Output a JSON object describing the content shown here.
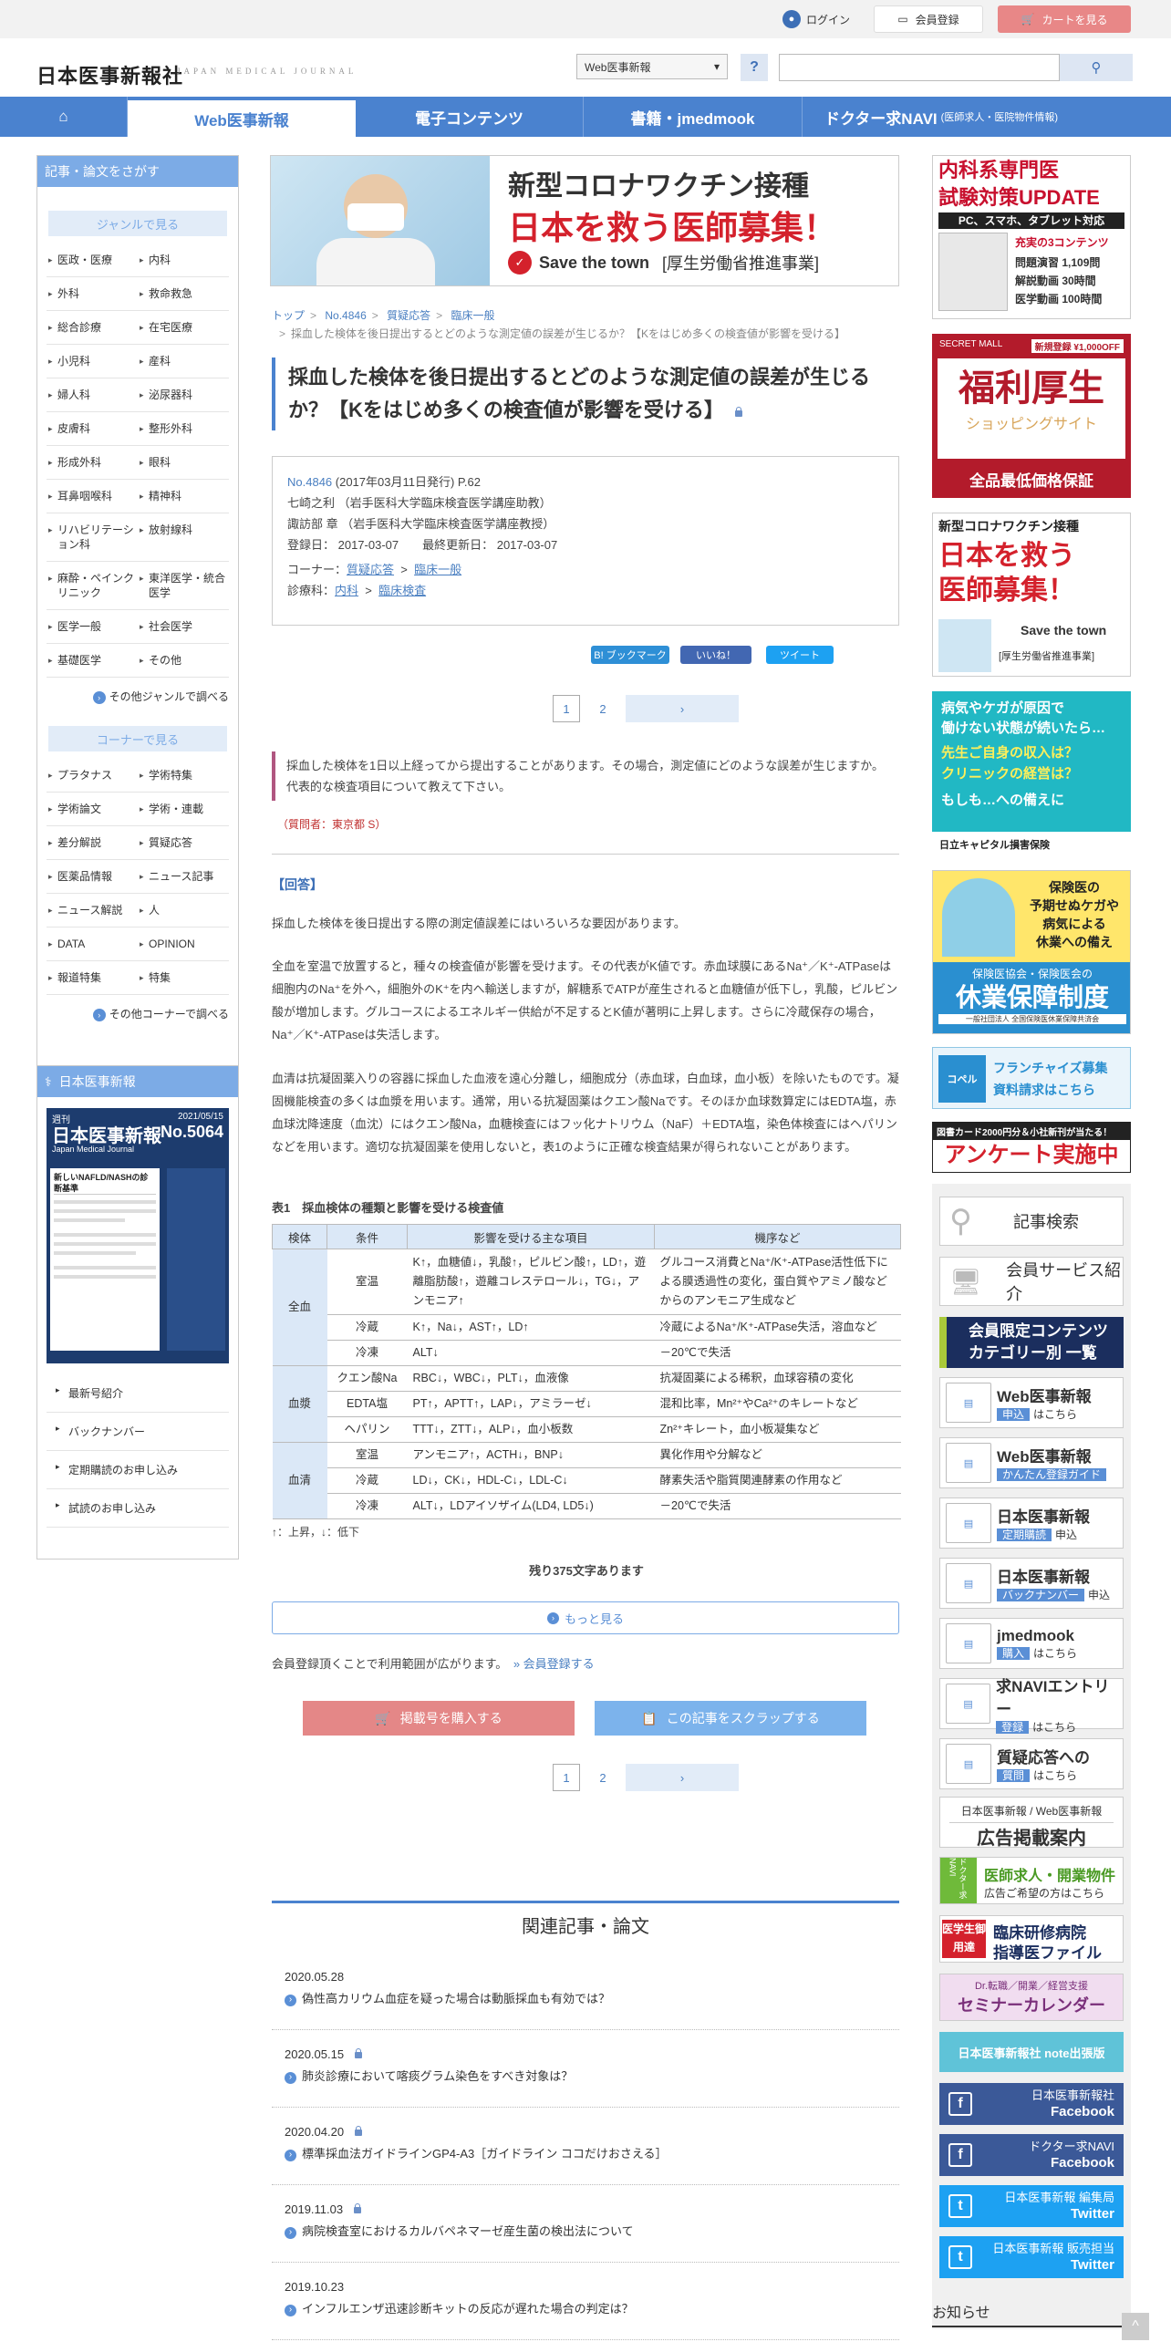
{
  "top": {
    "login": "ログイン",
    "register": "会員登録",
    "cart": "カートを見る"
  },
  "header": {
    "logo": "日本医事新報社",
    "logo_en": "JAPAN MEDICAL JOURNAL",
    "select": "Web医事新報",
    "help": "?"
  },
  "nav": [
    "Web医事新報",
    "電子コンテンツ",
    "書籍・jmedmook",
    "ドクター求NAVI"
  ],
  "nav_small": "(医師求人・医院物件情報)",
  "left": {
    "head": "記事・論文をさがす",
    "genre_title": "ジャンルで見る",
    "genres": [
      "医政・医療",
      "内科",
      "外科",
      "救命救急",
      "総合診療",
      "在宅医療",
      "小児科",
      "産科",
      "婦人科",
      "泌尿器科",
      "皮膚科",
      "整形外科",
      "形成外科",
      "眼科",
      "耳鼻咽喉科",
      "精神科",
      "リハビリテーション科",
      "放射線科",
      "麻酔・ペインクリニック",
      "東洋医学・統合医学",
      "医学一般",
      "社会医学",
      "基礎医学",
      "その他"
    ],
    "genre_more": "その他ジャンルで調べる",
    "corner_title": "コーナーで見る",
    "corners": [
      "プラタナス",
      "学術特集",
      "学術論文",
      "学術・連載",
      "差分解説",
      "質疑応答",
      "医薬品情報",
      "ニュース記事",
      "ニュース解説",
      "人",
      "DATA",
      "OPINION",
      "報道特集",
      "特集"
    ],
    "corner_more": "その他コーナーで調べる",
    "journal_head": "日本医事新報",
    "journal_title": "日本医事新報",
    "journal_en": "Japan Medical Journal",
    "journal_date": "2021/05/15",
    "journal_no": "No.5064",
    "journal_feature": "新しいNAFLD/NASHの診断基準",
    "links": [
      "最新号紹介",
      "バックナンバー",
      "定期購読のお申し込み",
      "試読のお申し込み"
    ]
  },
  "banner": {
    "line1": "新型コロナワクチン接種",
    "line2": "日本を救う医師募集！",
    "brand": "Save the town",
    "sub": "[厚生労働省推進事業]"
  },
  "breadcrumb": [
    "トップ",
    "No.4846",
    "質疑応答",
    "臨床一般"
  ],
  "breadcrumb_current": "採血した検体を後日提出するとどのような測定値の誤差が生じるか？【Kをはじめ多くの検査値が影響を受ける】",
  "article": {
    "title": "採血した検体を後日提出するとどのような測定値の誤差が生じるか？【Kをはじめ多くの検査値が影響を受ける】",
    "issue": "No.4846",
    "issue_info": " (2017年03月11日発行) P.62",
    "author1": "七崎之利 （岩手医科大学臨床検査医学講座助教）",
    "author2": "諏訪部 章 （岩手医科大学臨床検査医学講座教授）",
    "dates": "登録日： 2017-03-07　　最終更新日： 2017-03-07",
    "corner_label": "コーナー：",
    "corner1": "質疑応答",
    "corner2": "臨床一般",
    "dept_label": "診療科：",
    "dept1": "内科",
    "dept2": "臨床検査",
    "share": [
      "B! ブックマーク",
      "いいね！",
      "ツイート"
    ],
    "pages": [
      "1",
      "2"
    ],
    "question": "採血した検体を1日以上経ってから提出することがあります。その場合，測定値にどのような誤差が生じますか。代表的な検査項目について教えて下さい。",
    "asker": "（質問者：東京都 S）",
    "answer_head": "【回答】",
    "p1": "採血した検体を後日提出する際の測定値誤差にはいろいろな要因があります。",
    "p2": "全血を室温で放置すると，種々の検査値が影響を受けます。その代表がK値です。赤血球膜にあるNa⁺／K⁺-ATPaseは細胞内のNa⁺を外へ，細胞外のK⁺を内へ輸送しますが，解糖系でATPが産生されると血糖値が低下し，乳酸，ピルビン酸が増加します。グルコースによるエネルギー供給が不足するとK値が著明に上昇します。さらに冷蔵保存の場合，Na⁺／K⁺-ATPaseは失活します。",
    "p3": "血清は抗凝固薬入りの容器に採血した血液を遠心分離し，細胞成分（赤血球，白血球，血小板）を除いたものです。凝固機能検査の多くは血漿を用います。通常，用いる抗凝固薬はクエン酸Naです。そのほか血球数算定にはEDTA塩，赤血球沈降速度（血沈）にはクエン酸Na，血糖検査にはフッ化ナトリウム（NaF）＋EDTA塩，染色体検査にはヘパリンなどを用います。適切な抗凝固薬を使用しないと，表1のように正確な検査結果が得られないことがあります。",
    "table_caption": "表1　採血検体の種類と影響を受ける検査値",
    "table_headers": [
      "検体",
      "条件",
      "影響を受ける主な項目",
      "機序など"
    ],
    "table_groups": [
      "全血",
      "血漿",
      "血清"
    ],
    "rows": [
      {
        "c": "室温",
        "i": "K↑，血糖値↓，乳酸↑，ピルビン酸↑，LD↑，遊離脂肪酸↑，遊離コレステロール↓，TG↓，アンモニア↑",
        "m": "グルコース消費とNa⁺/K⁺-ATPase活性低下による膜透過性の変化，蛋白質やアミノ酸などからのアンモニア生成など"
      },
      {
        "c": "冷蔵",
        "i": "K↑，Na↓，AST↑，LD↑",
        "m": "冷蔵によるNa⁺/K⁺-ATPase失活，溶血など"
      },
      {
        "c": "冷凍",
        "i": "ALT↓",
        "m": "－20℃で失活"
      },
      {
        "c": "クエン酸Na",
        "i": "RBC↓，WBC↓，PLT↓，血液像",
        "m": "抗凝固薬による稀釈，血球容積の変化"
      },
      {
        "c": "EDTA塩",
        "i": "PT↑，APTT↑，LAP↓，アミラーゼ↓",
        "m": "混和比率，Mn²⁺やCa²⁺のキレートなど"
      },
      {
        "c": "ヘパリン",
        "i": "TTT↓，ZTT↓，ALP↓，血小板数",
        "m": "Zn²⁺キレート，血小板凝集など"
      },
      {
        "c": "室温",
        "i": "アンモニア↑，ACTH↓，BNP↓",
        "m": "異化作用や分解など"
      },
      {
        "c": "冷蔵",
        "i": "LD↓，CK↓，HDL-C↓，LDL-C↓",
        "m": "酵素失活や脂質関連酵素の作用など"
      },
      {
        "c": "冷凍",
        "i": "ALT↓，LDアイソザイム(LD4, LD5↓)",
        "m": "－20℃で失活"
      }
    ],
    "table_note": "↑：上昇，↓：低下",
    "remaining": "残り375文字あります",
    "more_btn": "もっと見る",
    "member_note": "会員登録頂くことで利用範囲が広がります。",
    "member_link": "» 会員登録する",
    "buy_btn": "掲載号を購入する",
    "scrap_btn": "この記事をスクラップする"
  },
  "related": {
    "title": "関連記事・論文",
    "items": [
      {
        "date": "2020.05.28",
        "title": "偽性高カリウム血症を疑った場合は動脈採血も有効では？",
        "lock": false
      },
      {
        "date": "2020.05.15",
        "title": "肺炎診療において喀痰グラム染色をすべき対象は？",
        "lock": true
      },
      {
        "date": "2020.04.20",
        "title": "標準採血法ガイドラインGP4-A3［ガイドライン ココだけおさえる］",
        "lock": true
      },
      {
        "date": "2019.11.03",
        "title": "病院検査室におけるカルバペネマーゼ産生菌の検出法について",
        "lock": true
      },
      {
        "date": "2019.10.23",
        "title": "インフルエンザ迅速診断キットの反応が遅れた場合の判定は？",
        "lock": false
      }
    ]
  },
  "right": {
    "ad1": {
      "l1": "内科系専門医",
      "l2": "試験対策UPDATE",
      "l3": "PC、スマホ、タブレット対応",
      "l4": "充実の3コンテンツ",
      "l5": "問題演習 1,109問",
      "l6": "解説動画 30時間",
      "l7": "医学動画 100時間"
    },
    "ad2": {
      "l1": "SECRET MALL",
      "l2": "新規登録 ¥1,000OFF",
      "l3": "福利厚生",
      "l4": "ショッピングサイト",
      "l5": "全品最低価格保証"
    },
    "ad3": {
      "l1": "新型コロナワクチン接種",
      "l2": "日本を救う",
      "l3": "医師募集！",
      "l4": "Save the town",
      "l5": "[厚生労働省推進事業]"
    },
    "ad4": {
      "l1": "病気やケガが原因で",
      "l2": "働けない状態が続いたら…",
      "l3": "先生ご自身の収入は？",
      "l4": "クリニックの経営は？",
      "l5": "もしも…への備えに",
      "l6": "日立キャピタル損害保険"
    },
    "ad5": {
      "l1": "保険医の",
      "l2": "予期せぬケガや",
      "l3": "病気による",
      "l4": "休業への備え",
      "l5": "保険医協会・保険医会の",
      "l6": "休業保障制度",
      "l7": "一般社団法人 全国保険医休業保障共済会"
    },
    "ad6": {
      "l1": "コペル",
      "l2": "フランチャイズ募集",
      "l3": "資料請求はこちら"
    },
    "ad7": {
      "l1": "図書カード2000円分＆小社新刊が当たる！",
      "l2": "アンケート実施中"
    },
    "search": "記事検索",
    "service": "会員サービス紹介",
    "members1": "会員限定コンテンツ",
    "members2": "カテゴリー別 一覧",
    "btns": [
      {
        "t": "Web医事新報",
        "s": "申込",
        "e": "はこちら"
      },
      {
        "t": "Web医事新報",
        "s": "かんたん登録ガイド",
        "e": ""
      },
      {
        "t": "日本医事新報",
        "s": "定期購読",
        "e": "申込"
      },
      {
        "t": "日本医事新報",
        "s": "バックナンバー",
        "e": "申込"
      },
      {
        "t": "jmedmook",
        "s": "購入",
        "e": "はこちら"
      },
      {
        "t": "求NAVIエントリー",
        "s": "登録",
        "e": "はこちら"
      },
      {
        "t": "質疑応答への",
        "s": "質問",
        "e": "はこちら"
      }
    ],
    "ad_info1": "日本医事新報 / Web医事新報",
    "ad_info2": "広告掲載案内",
    "navi1": "医師求人・開業物件",
    "navi2": "広告ご希望の方はこちら",
    "navi_tag": "ドクター求NAVI",
    "file_tag": "医学生御用達",
    "file1": "臨床研修病院",
    "file2": "指導医ファイル",
    "sem1": "Dr.転職／開業／経営支援",
    "sem2": "セミナーカレンダー",
    "note": "日本医事新報社 note出張版",
    "sns": [
      {
        "l1": "日本医事新報社",
        "l2": "Facebook",
        "color": "#3b5998"
      },
      {
        "l1": "ドクター求NAVI",
        "l2": "Facebook",
        "color": "#3b5998"
      },
      {
        "l1": "日本医事新報 編集局",
        "l2": "Twitter",
        "color": "#1da1f2"
      },
      {
        "l1": "日本医事新報 販売担当",
        "l2": "Twitter",
        "color": "#1da1f2"
      }
    ],
    "news": "お知らせ"
  }
}
